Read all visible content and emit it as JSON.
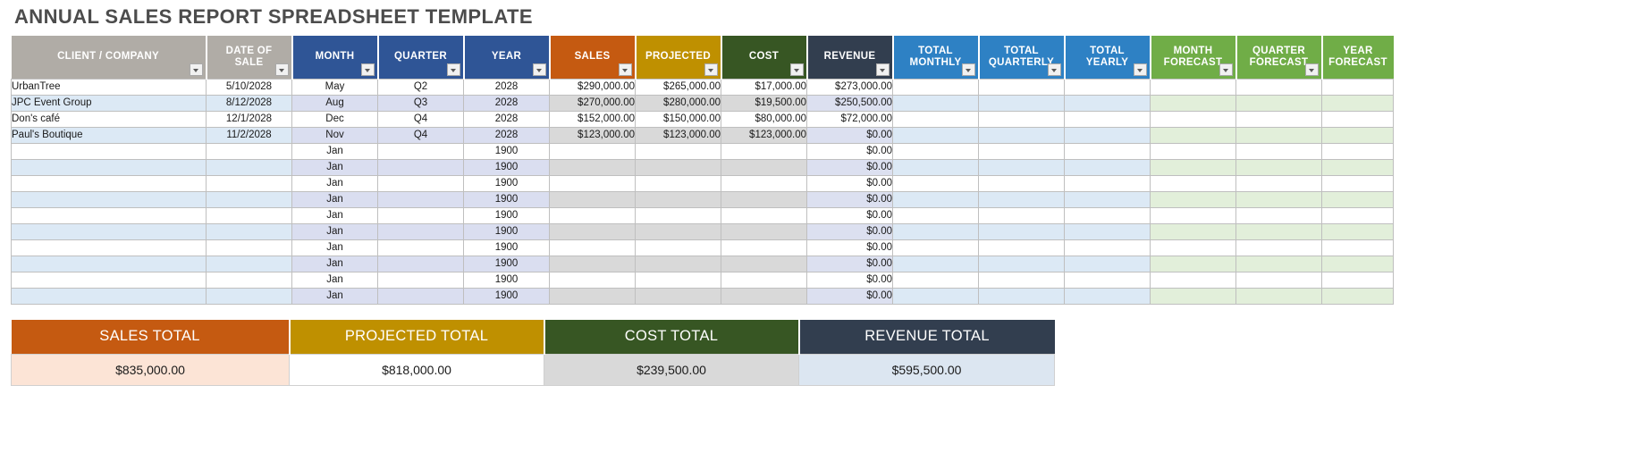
{
  "page_title": "ANNUAL SALES REPORT SPREADSHEET TEMPLATE",
  "colors": {
    "gray_header": "#b0aca6",
    "blue_header": "#2f5596",
    "orange_header": "#c55a11",
    "gold_header": "#bf9000",
    "green_header": "#375623",
    "dark_navy_header": "#323e4f",
    "light_blue_header": "#2e81c4",
    "light_green_header": "#70ad47",
    "sales_total_fill": "#fce4d6",
    "projected_total_fill": "#ffffff",
    "cost_total_fill": "#d9d9d9",
    "revenue_total_fill": "#dce6f1",
    "row_stripe": "#dce9f5",
    "row_stripe_month": "#dadef0",
    "row_stripe_money": "#d9d9d9",
    "row_stripe_revenue": "#dce0f0",
    "row_stripe_forecast": "#e2efda",
    "title_color": "#4c4c4c"
  },
  "table": {
    "columns": [
      {
        "label": "CLIENT / COMPANY",
        "color_key": "gray_header",
        "filter": true,
        "align": "left"
      },
      {
        "label": "DATE OF SALE",
        "color_key": "gray_header",
        "filter": true,
        "align": "center"
      },
      {
        "label": "MONTH",
        "color_key": "blue_header",
        "filter": true,
        "align": "center"
      },
      {
        "label": "QUARTER",
        "color_key": "blue_header",
        "filter": true,
        "align": "center"
      },
      {
        "label": "YEAR",
        "color_key": "blue_header",
        "filter": true,
        "align": "center"
      },
      {
        "label": "SALES",
        "color_key": "orange_header",
        "filter": true,
        "align": "right"
      },
      {
        "label": "PROJECTED",
        "color_key": "gold_header",
        "filter": true,
        "align": "right"
      },
      {
        "label": "COST",
        "color_key": "green_header",
        "filter": true,
        "align": "right"
      },
      {
        "label": "REVENUE",
        "color_key": "dark_navy_header",
        "filter": true,
        "align": "right"
      },
      {
        "label": "TOTAL MONTHLY",
        "color_key": "light_blue_header",
        "filter": true,
        "align": "right"
      },
      {
        "label": "TOTAL QUARTERLY",
        "color_key": "light_blue_header",
        "filter": true,
        "align": "right"
      },
      {
        "label": "TOTAL YEARLY",
        "color_key": "light_blue_header",
        "filter": true,
        "align": "right"
      },
      {
        "label": "MONTH FORECAST",
        "color_key": "light_green_header",
        "filter": true,
        "align": "right"
      },
      {
        "label": "QUARTER FORECAST",
        "color_key": "light_green_header",
        "filter": true,
        "align": "right"
      },
      {
        "label": "YEAR FORECAST",
        "color_key": "light_green_header",
        "filter": false,
        "align": "right"
      }
    ],
    "rows": [
      [
        "UrbanTree",
        "5/10/2028",
        "May",
        "Q2",
        "2028",
        "$290,000.00",
        "$265,000.00",
        "$17,000.00",
        "$273,000.00",
        "",
        "",
        "",
        "",
        "",
        ""
      ],
      [
        "JPC Event Group",
        "8/12/2028",
        "Aug",
        "Q3",
        "2028",
        "$270,000.00",
        "$280,000.00",
        "$19,500.00",
        "$250,500.00",
        "",
        "",
        "",
        "",
        "",
        ""
      ],
      [
        "Don's café",
        "12/1/2028",
        "Dec",
        "Q4",
        "2028",
        "$152,000.00",
        "$150,000.00",
        "$80,000.00",
        "$72,000.00",
        "",
        "",
        "",
        "",
        "",
        ""
      ],
      [
        "Paul's Boutique",
        "11/2/2028",
        "Nov",
        "Q4",
        "2028",
        "$123,000.00",
        "$123,000.00",
        "$123,000.00",
        "$0.00",
        "",
        "",
        "",
        "",
        "",
        ""
      ],
      [
        "",
        "",
        "Jan",
        "",
        "1900",
        "",
        "",
        "",
        "$0.00",
        "",
        "",
        "",
        "",
        "",
        ""
      ],
      [
        "",
        "",
        "Jan",
        "",
        "1900",
        "",
        "",
        "",
        "$0.00",
        "",
        "",
        "",
        "",
        "",
        ""
      ],
      [
        "",
        "",
        "Jan",
        "",
        "1900",
        "",
        "",
        "",
        "$0.00",
        "",
        "",
        "",
        "",
        "",
        ""
      ],
      [
        "",
        "",
        "Jan",
        "",
        "1900",
        "",
        "",
        "",
        "$0.00",
        "",
        "",
        "",
        "",
        "",
        ""
      ],
      [
        "",
        "",
        "Jan",
        "",
        "1900",
        "",
        "",
        "",
        "$0.00",
        "",
        "",
        "",
        "",
        "",
        ""
      ],
      [
        "",
        "",
        "Jan",
        "",
        "1900",
        "",
        "",
        "",
        "$0.00",
        "",
        "",
        "",
        "",
        "",
        ""
      ],
      [
        "",
        "",
        "Jan",
        "",
        "1900",
        "",
        "",
        "",
        "$0.00",
        "",
        "",
        "",
        "",
        "",
        ""
      ],
      [
        "",
        "",
        "Jan",
        "",
        "1900",
        "",
        "",
        "",
        "$0.00",
        "",
        "",
        "",
        "",
        "",
        ""
      ],
      [
        "",
        "",
        "Jan",
        "",
        "1900",
        "",
        "",
        "",
        "$0.00",
        "",
        "",
        "",
        "",
        "",
        ""
      ],
      [
        "",
        "",
        "Jan",
        "",
        "1900",
        "",
        "",
        "",
        "$0.00",
        "",
        "",
        "",
        "",
        "",
        ""
      ]
    ]
  },
  "totals": {
    "cells": [
      {
        "label": "SALES TOTAL",
        "value": "$835,000.00",
        "header_color_key": "orange_header",
        "value_fill_key": "sales_total_fill"
      },
      {
        "label": "PROJECTED TOTAL",
        "value": "$818,000.00",
        "header_color_key": "gold_header",
        "value_fill_key": "projected_total_fill"
      },
      {
        "label": "COST TOTAL",
        "value": "$239,500.00",
        "header_color_key": "green_header",
        "value_fill_key": "cost_total_fill"
      },
      {
        "label": "REVENUE TOTAL",
        "value": "$595,500.00",
        "header_color_key": "dark_navy_header",
        "value_fill_key": "revenue_total_fill"
      }
    ]
  }
}
